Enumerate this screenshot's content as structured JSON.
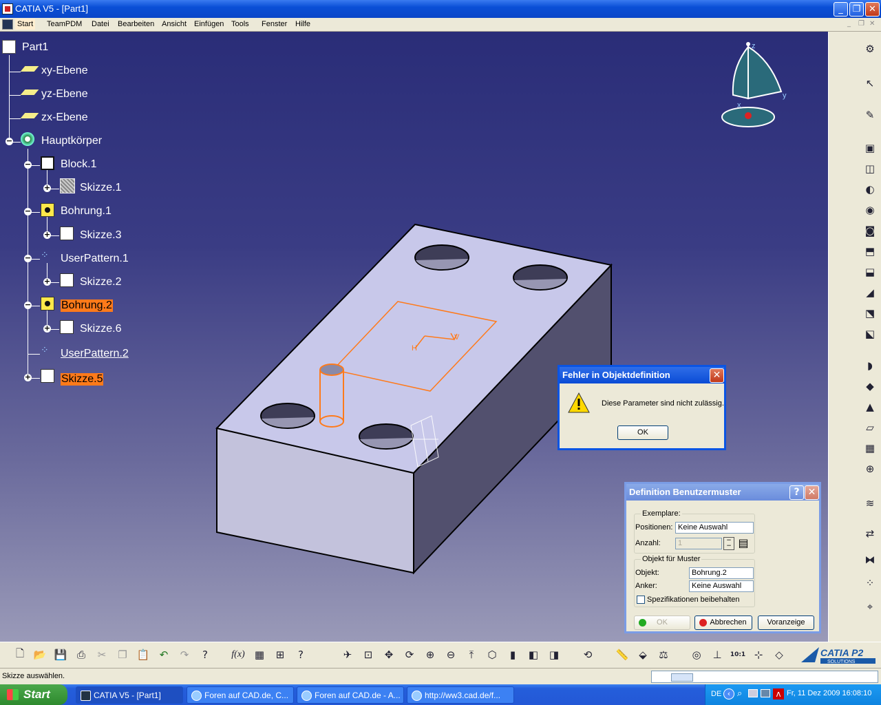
{
  "window": {
    "title": "CATIA V5 - [Part1]"
  },
  "menu": {
    "items": [
      "Start",
      "TeamPDM",
      "Datei",
      "Bearbeiten",
      "Ansicht",
      "Einfügen",
      "Tools",
      "Fenster",
      "Hilfe"
    ]
  },
  "tree": {
    "root": "Part1",
    "nodes": [
      {
        "label": "xy-Ebene"
      },
      {
        "label": "yz-Ebene"
      },
      {
        "label": "zx-Ebene"
      },
      {
        "label": "Hauptkörper"
      },
      {
        "label": "Block.1"
      },
      {
        "label": "Skizze.1"
      },
      {
        "label": "Bohrung.1"
      },
      {
        "label": "Skizze.3"
      },
      {
        "label": "UserPattern.1"
      },
      {
        "label": "Skizze.2"
      },
      {
        "label": "Bohrung.2"
      },
      {
        "label": "Skizze.6"
      },
      {
        "label": "UserPattern.2"
      },
      {
        "label": "Skizze.5"
      }
    ]
  },
  "compass": {
    "x": "x",
    "y": "y",
    "z": "z"
  },
  "sketch_axis": {
    "h": "H",
    "v": "V"
  },
  "error_dialog": {
    "title": "Fehler in Objektdefinition",
    "message": "Diese Parameter sind nicht zulässig.",
    "ok": "OK"
  },
  "pattern_dialog": {
    "title": "Definition Benutzermuster",
    "help": "?",
    "instances_group": "Exemplare:",
    "positions_label": "Positionen:",
    "positions_value": "Keine Auswahl",
    "count_label": "Anzahl:",
    "count_value": "1",
    "object_group": "Objekt für Muster",
    "object_label": "Objekt:",
    "object_value": "Bohrung.2",
    "anchor_label": "Anker:",
    "anchor_value": "Keine Auswahl",
    "keep_specs_label": "Spezifikationen beibehalten",
    "ok": "OK",
    "cancel": "Abbrechen",
    "preview": "Voranzeige"
  },
  "statusbar": {
    "message": "Skizze auswählen."
  },
  "taskbar": {
    "start": "Start",
    "tasks": [
      "CATIA V5 - [Part1]",
      "Foren auf CAD.de, C...",
      "Foren auf CAD.de - A...",
      "http://ww3.cad.de/f..."
    ],
    "lang": "DE",
    "clock": "Fr, 11 Dez 2009 16:08:10"
  },
  "logo": {
    "text": "CATIA P2",
    "sub": "SOLUTIONS"
  },
  "fx_label": "f(x)",
  "scale_label": "10:1",
  "colors": {
    "selection": "#ff7a1a",
    "titlebar": "#0a4fd6",
    "highlight_edge": "#ff7a1a",
    "part_top": "#c8c8ea"
  }
}
